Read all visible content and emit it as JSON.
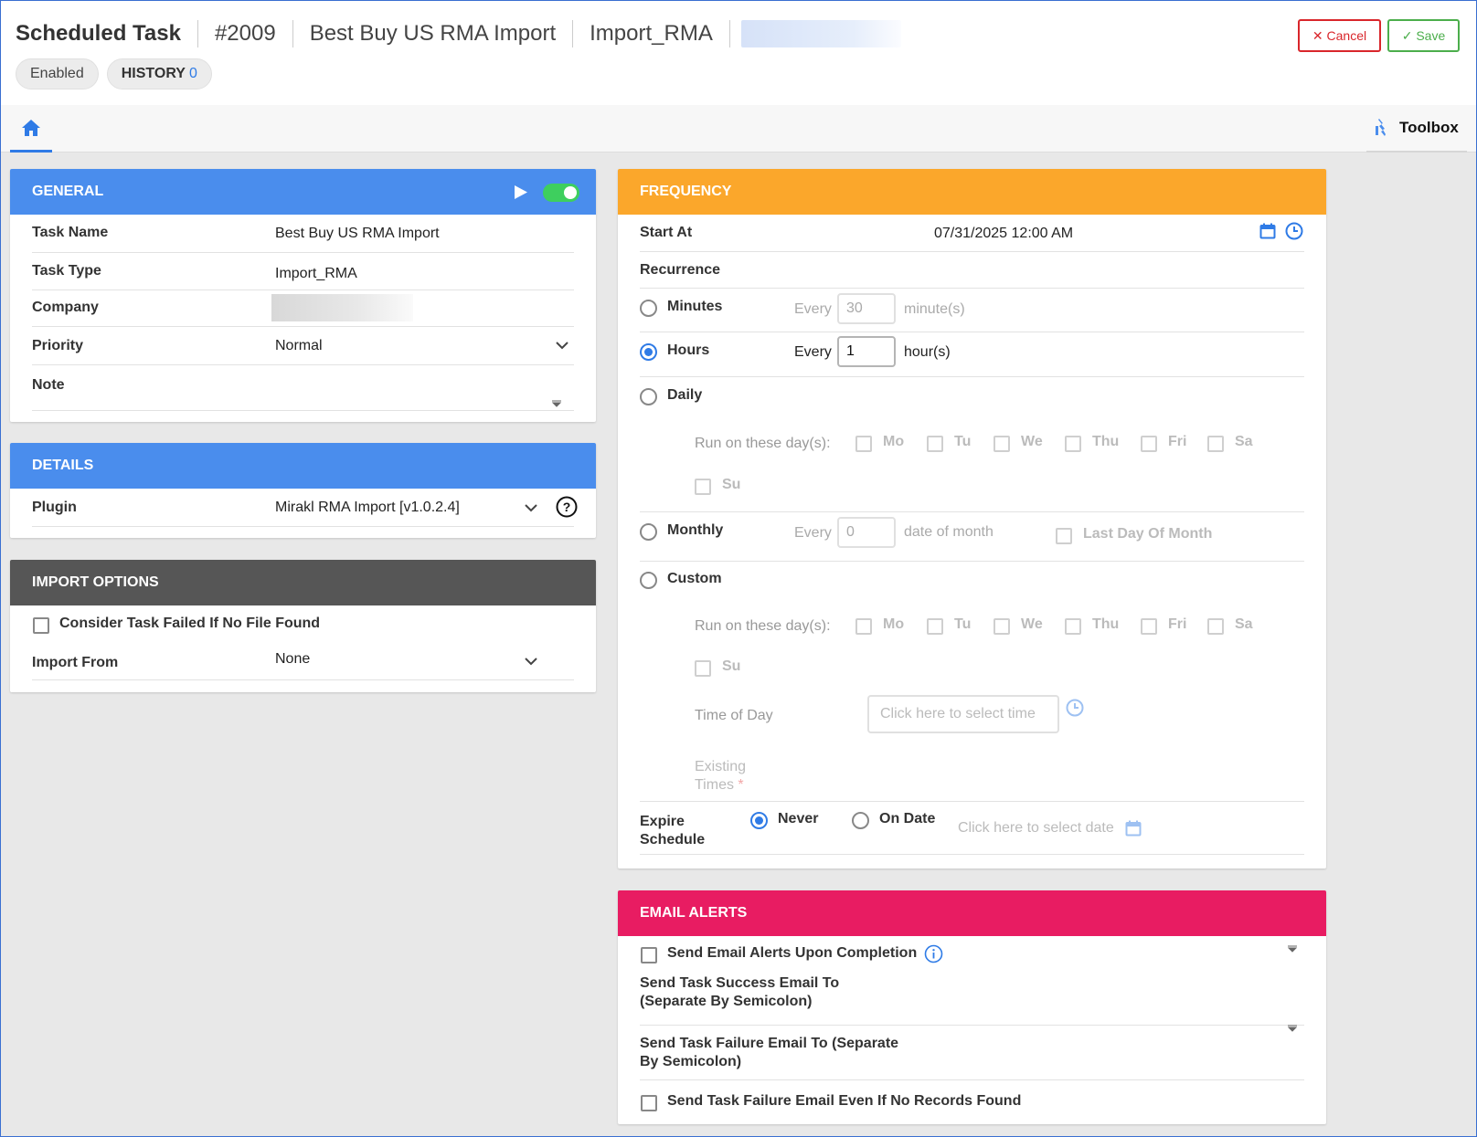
{
  "header": {
    "title": "Scheduled Task",
    "task_id": "#2009",
    "task_name": "Best Buy US RMA Import",
    "task_type": "Import_RMA",
    "status_chip": "Enabled",
    "history_label": "HISTORY",
    "history_count": "0",
    "cancel_label": "Cancel",
    "save_label": "Save"
  },
  "tabs": {
    "home_icon": "home-icon",
    "toolbox_label": "Toolbox"
  },
  "general": {
    "heading": "GENERAL",
    "fields": {
      "task_name_label": "Task Name",
      "task_name_value": "Best Buy US RMA Import",
      "task_type_label": "Task Type",
      "task_type_value": "Import_RMA",
      "company_label": "Company",
      "priority_label": "Priority",
      "priority_value": "Normal",
      "note_label": "Note"
    }
  },
  "details": {
    "heading": "DETAILS",
    "plugin_label": "Plugin",
    "plugin_value": "Mirakl RMA Import [v1.0.2.4]"
  },
  "import_options": {
    "heading": "IMPORT OPTIONS",
    "fail_no_file_label": "Consider Task Failed If No File Found",
    "import_from_label": "Import From",
    "import_from_value": "None"
  },
  "frequency": {
    "heading": "FREQUENCY",
    "start_at_label": "Start At",
    "start_at_value": "07/31/2025 12:00 AM",
    "recurrence_label": "Recurrence",
    "minutes": {
      "label": "Minutes",
      "every": "Every",
      "value": "30",
      "unit": "minute(s)"
    },
    "hours": {
      "label": "Hours",
      "every": "Every",
      "value": "1",
      "unit": "hour(s)"
    },
    "daily": {
      "label": "Daily",
      "run_on": "Run on these day(s):"
    },
    "days": [
      "Mo",
      "Tu",
      "We",
      "Thu",
      "Fri",
      "Sa",
      "Su"
    ],
    "monthly": {
      "label": "Monthly",
      "every": "Every",
      "value": "0",
      "unit": "date of month",
      "last_day": "Last Day Of Month"
    },
    "custom": {
      "label": "Custom",
      "run_on": "Run on these day(s):",
      "time_of_day": "Time of Day",
      "time_placeholder": "Click here to select time",
      "existing_1": "Existing",
      "existing_2": "Times",
      "required": "*"
    },
    "expire": {
      "label_1": "Expire",
      "label_2": "Schedule",
      "never": "Never",
      "on_date": "On Date",
      "date_placeholder": "Click here to select date"
    },
    "selected": "Hours"
  },
  "email_alerts": {
    "heading": "EMAIL ALERTS",
    "send_on_completion": "Send Email Alerts Upon Completion",
    "success_label_1": "Send Task Success Email To",
    "success_label_2": "(Separate By Semicolon)",
    "failure_label_1": "Send Task Failure Email To (Separate",
    "failure_label_2": "By Semicolon)",
    "failure_no_records": "Send Task Failure Email Even If No Records Found"
  },
  "colors": {
    "general_header": "#4a8ded",
    "import_header": "#565656",
    "frequency_header": "#fba72b",
    "email_header": "#e81c62",
    "accent": "#2f7be6",
    "cancel": "#d9262b",
    "save": "#4cae4c",
    "toggle": "#3ecf5e"
  }
}
